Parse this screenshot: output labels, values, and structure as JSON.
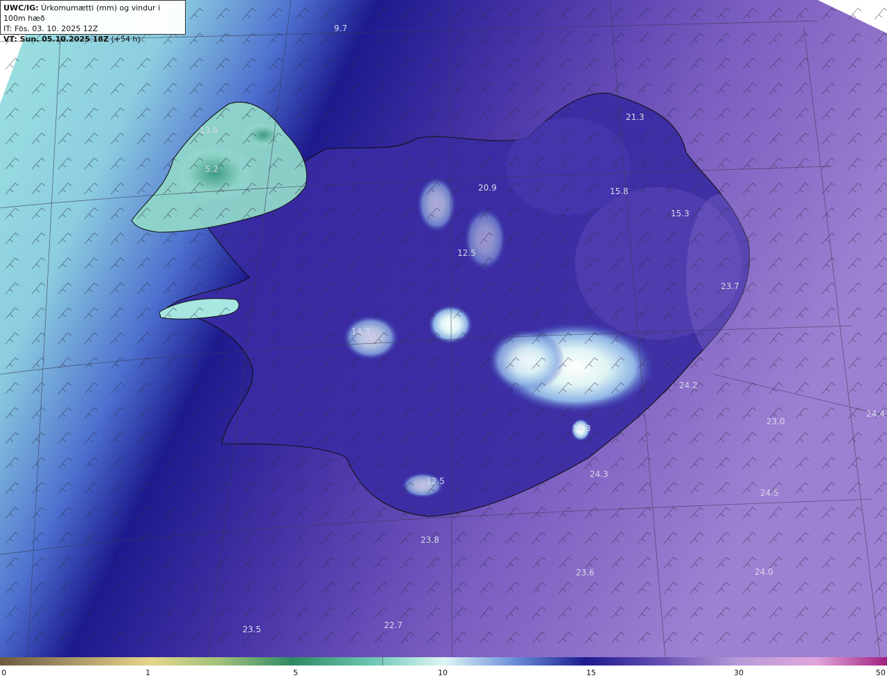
{
  "header": {
    "model_label": "UWC/IG:",
    "title_rest": " Úrkomumætti (mm) og vindur i 100m hæð",
    "issue_time": "IT: Fös. 03. 10. 2025 12Z",
    "valid_label": "VT: Sun. 05.10.2025 18Z",
    "valid_rest": " (+54 h)"
  },
  "colors": {
    "sea_dark": "#1e1a8c",
    "violet": "#6a52b3",
    "light_violet": "#a07fd0",
    "cyan": "#9de3e0",
    "teal": "#3e9b86",
    "coast": "#111111"
  },
  "labels": [
    {
      "text": "9.7"
    },
    {
      "text": "13.0"
    },
    {
      "text": "5.2"
    },
    {
      "text": "21.3"
    },
    {
      "text": "20.9"
    },
    {
      "text": "15.8"
    },
    {
      "text": "15.3"
    },
    {
      "text": "12.5"
    },
    {
      "text": "23.7"
    },
    {
      "text": "14.3"
    },
    {
      "text": "24.2"
    },
    {
      "text": "23.0"
    },
    {
      "text": "24.4"
    },
    {
      "text": "14.3"
    },
    {
      "text": "24.3"
    },
    {
      "text": "12.5"
    },
    {
      "text": "24.5"
    },
    {
      "text": "23.8"
    },
    {
      "text": "23.6"
    },
    {
      "text": "24.0"
    },
    {
      "text": "23.5"
    },
    {
      "text": "22.7"
    }
  ],
  "colorbar": {
    "ticks": [
      "0",
      "1",
      "5",
      "10",
      "15",
      "30",
      "50"
    ]
  }
}
